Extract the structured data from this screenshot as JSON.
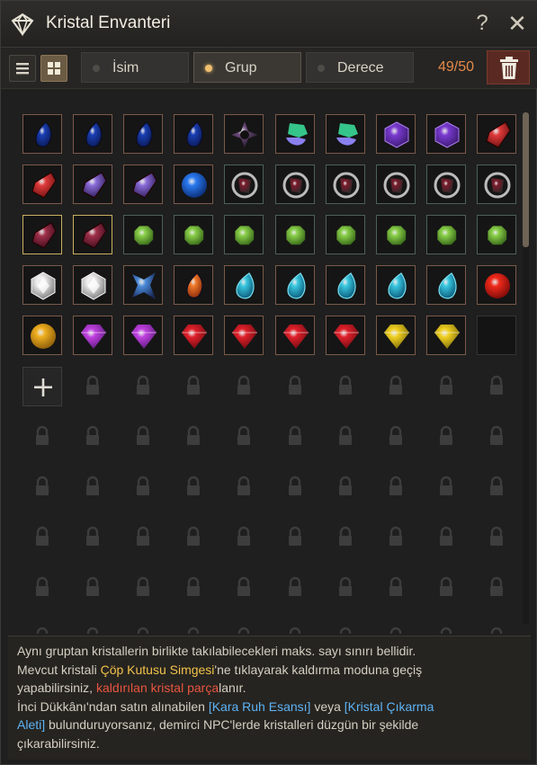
{
  "window": {
    "title": "Kristal Envanteri",
    "help_label": "?",
    "close_label": "✕"
  },
  "toolbar": {
    "view_modes": [
      {
        "name": "list-view-icon",
        "active": false
      },
      {
        "name": "grid-view-icon",
        "active": true
      }
    ],
    "sort_options": [
      {
        "label": "İsim",
        "active": false
      },
      {
        "label": "Grup",
        "active": true
      },
      {
        "label": "Derece",
        "active": false
      }
    ],
    "count": "49/50",
    "trash_icon": "trash-icon"
  },
  "grid": {
    "columns": 10,
    "rows": [
      [
        "sapphire-dark",
        "sapphire-dark",
        "sapphire-dark",
        "sapphire-dark",
        "black-gem-cross",
        "green-blue-ore",
        "green-blue-ore",
        "violet-hex",
        "violet-hex",
        "red-shard"
      ],
      [
        "red-shard",
        "violet-shard",
        "violet-shard",
        "blue-orb",
        "dark-ruby-ring",
        "dark-ruby-ring",
        "dark-ruby-ring",
        "dark-ruby-ring",
        "dark-ruby-ring",
        "dark-ruby-ring"
      ],
      [
        "garnet-y",
        "garnet-y",
        "green-peridot",
        "green-peridot",
        "green-peridot",
        "green-peridot",
        "green-peridot",
        "green-peridot",
        "green-peridot",
        "green-peridot"
      ],
      [
        "white-hex",
        "white-hex",
        "blue-spike",
        "fire-drop",
        "cyan-drop",
        "cyan-drop",
        "cyan-drop",
        "cyan-drop",
        "cyan-drop",
        "red-orb"
      ],
      [
        "gold-orb",
        "purple-brilliant",
        "purple-brilliant",
        "ruby-brilliant",
        "ruby-brilliant",
        "ruby-brilliant",
        "ruby-brilliant",
        "yellow-brilliant",
        "yellow-brilliant",
        "empty"
      ]
    ],
    "add_icon": "plus-icon",
    "locked_rows": 6
  },
  "info": {
    "line1": "Aynı gruptan kristallerin birlikte takılabilecekleri maks. sayı sınırı bellidir.",
    "line2a": "Mevcut kristali ",
    "line2b": "Çöp Kutusu Simgesi",
    "line2c": "'ne tıklayarak kaldırma moduna geçiş",
    "line3a": "yapabilirsiniz, ",
    "line3b": "kaldırılan kristal parça",
    "line3c": "lanır.",
    "line4a": "İnci Dükkânı'ndan satın alınabilen ",
    "line4b": "[Kara Ruh Esansı]",
    "line4c": " veya ",
    "line4d": "[Kristal Çıkarma",
    "line5a": "Aleti]",
    "line5b": " bulunduruyorsanız, demirci NPC'lerde kristalleri düzgün bir şekilde",
    "line6": "çıkarabilirsiniz."
  },
  "colors": {
    "accent": "#f2c24a",
    "warn": "#e95540",
    "link": "#5db3f5",
    "count": "#e58a4a"
  }
}
